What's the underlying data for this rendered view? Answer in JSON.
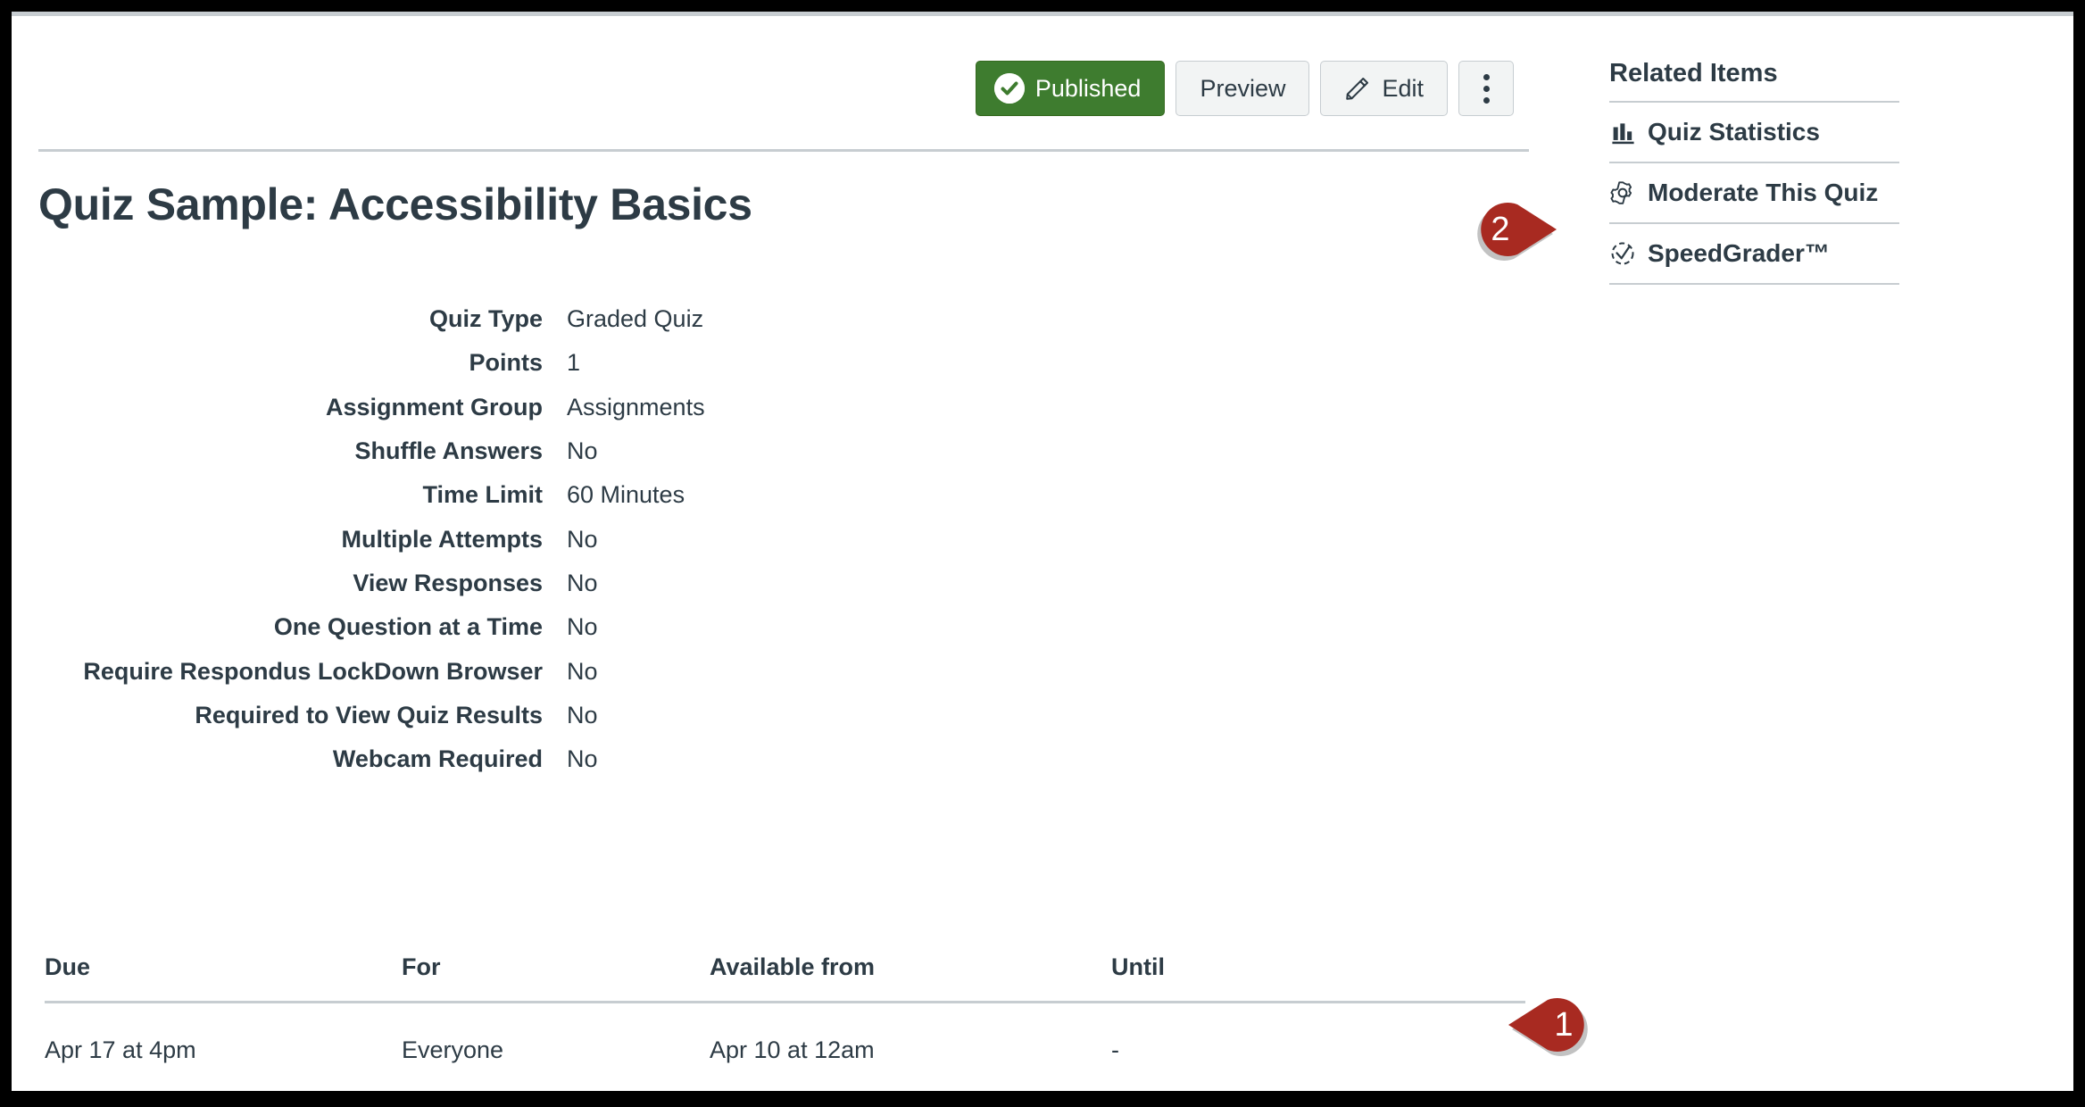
{
  "header": {
    "published_label": "Published",
    "preview_label": "Preview",
    "edit_label": "Edit",
    "more_label": "More options",
    "published_color": "#3e7c2f"
  },
  "main": {
    "title": "Quiz Sample: Accessibility Basics",
    "details": [
      {
        "label": "Quiz Type",
        "value": "Graded Quiz"
      },
      {
        "label": "Points",
        "value": "1"
      },
      {
        "label": "Assignment Group",
        "value": "Assignments"
      },
      {
        "label": "Shuffle Answers",
        "value": "No"
      },
      {
        "label": "Time Limit",
        "value": "60 Minutes"
      },
      {
        "label": "Multiple Attempts",
        "value": "No"
      },
      {
        "label": "View Responses",
        "value": "No"
      },
      {
        "label": "One Question at a Time",
        "value": "No"
      },
      {
        "label": "Require Respondus LockDown Browser",
        "value": "No"
      },
      {
        "label": "Required to View Quiz Results",
        "value": "No"
      },
      {
        "label": "Webcam Required",
        "value": "No"
      }
    ],
    "dates_table": {
      "columns": [
        "Due",
        "For",
        "Available from",
        "Until"
      ],
      "rows": [
        [
          "Apr 17 at 4pm",
          "Everyone",
          "Apr 10 at 12am",
          "-"
        ]
      ]
    }
  },
  "sidebar": {
    "heading": "Related Items",
    "items": [
      {
        "label": "Quiz Statistics",
        "icon": "bar-chart-icon"
      },
      {
        "label": "Moderate This Quiz",
        "icon": "gear-icon"
      },
      {
        "label": "SpeedGrader™",
        "icon": "speedgrader-icon"
      }
    ]
  },
  "callouts": [
    {
      "number": "1",
      "direction": "left",
      "color": "#a82a21"
    },
    {
      "number": "2",
      "direction": "right",
      "color": "#a82a21"
    }
  ]
}
